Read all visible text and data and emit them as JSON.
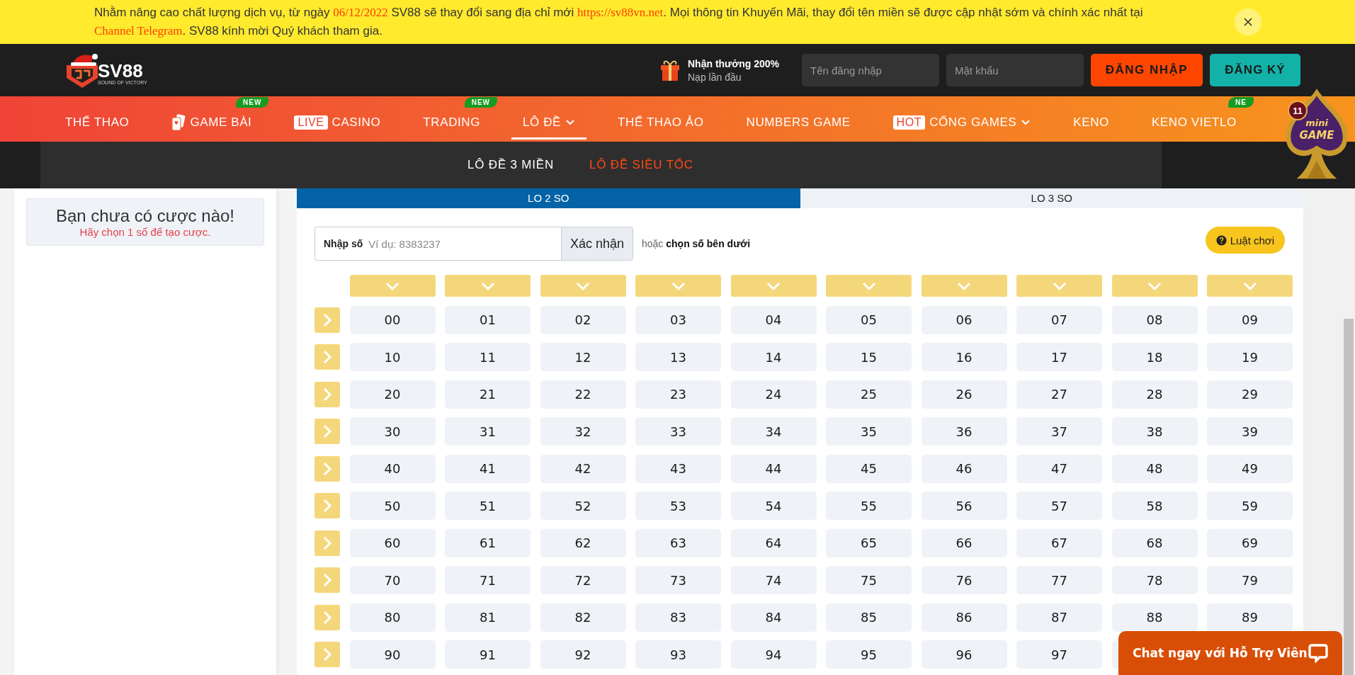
{
  "notice": {
    "segments": [
      {
        "kind": "text",
        "text": "Nhằm nâng cao chất lượng dịch vụ, từ ngày "
      },
      {
        "kind": "highlight",
        "text": "06/12/2022"
      },
      {
        "kind": "text",
        "text": " SV88 sẽ thay đổi sang địa chỉ mới "
      },
      {
        "kind": "link",
        "text": "https://sv88vn.net"
      },
      {
        "kind": "text",
        "text": ". Mọi thông tin Khuyến Mãi, thay đổi tên miền sẽ được cập nhật sớm và chính xác nhất tại "
      },
      {
        "kind": "link",
        "text": "Channel Telegram"
      },
      {
        "kind": "text",
        "text": ". SV88 kính mời Quý khách tham gia."
      }
    ]
  },
  "header": {
    "logo": {
      "name": "SV88",
      "tagline": "SOUND OF VICTORY"
    },
    "promo": {
      "title": "Nhận thưởng 200%",
      "subtitle": "Nạp lần đầu"
    },
    "username": {
      "placeholder": "Tên đăng nhập"
    },
    "password": {
      "placeholder": "Mật khẩu"
    },
    "buttons": [
      {
        "kind": "login",
        "label": "ĐĂNG NHẬP"
      },
      {
        "kind": "register",
        "label": "ĐĂNG KÝ"
      }
    ]
  },
  "nav": [
    {
      "label": "THỂ THAO",
      "selected": false
    },
    {
      "label": "GAME BÀI",
      "kind": "cards",
      "badge": "NEW",
      "selected": false
    },
    {
      "label": "CASINO",
      "prefix": "LIVE",
      "selected": false
    },
    {
      "label": "TRADING",
      "badge": "NEW",
      "selected": false
    },
    {
      "label": "LÔ ĐỀ",
      "caret": true,
      "selected": true
    },
    {
      "label": "THỂ THAO ẢO",
      "selected": false
    },
    {
      "label": "NUMBERS GAME",
      "selected": false
    },
    {
      "label": "CỔNG GAMES",
      "prefix": "HOT",
      "caret": true,
      "selected": false
    },
    {
      "label": "KENO",
      "selected": false
    },
    {
      "label": "KENO VIETLO",
      "badge": "NE",
      "selected": false
    }
  ],
  "submenu": [
    {
      "label": "LÔ ĐỀ 3 MIỀN",
      "selected": false
    },
    {
      "label": "LÔ ĐỀ SIÊU TỐC",
      "selected": true
    }
  ],
  "mini_game": {
    "count": "11",
    "line_1": "mini",
    "line_2": "GAME"
  },
  "bet_slip": {
    "title": "Bạn chưa có cược nào!",
    "hint": "Hãy chọn 1 số để tạo cược."
  },
  "tabs": [
    {
      "label": "LO 2 SO",
      "selected": true
    },
    {
      "label": "LO 3 SO",
      "selected": false
    }
  ],
  "entry": {
    "label": "Nhập số",
    "placeholder": "Ví dụ: 8383237",
    "button": "Xác nhận",
    "note": "hoặc **chọn số bên dưới**"
  },
  "rules_button": {
    "label": "Luật chơi"
  },
  "grid": {
    "rows": [
      [
        "00",
        "01",
        "02",
        "03",
        "04",
        "05",
        "06",
        "07",
        "08",
        "09"
      ],
      [
        "10",
        "11",
        "12",
        "13",
        "14",
        "15",
        "16",
        "17",
        "18",
        "19"
      ],
      [
        "20",
        "21",
        "22",
        "23",
        "24",
        "25",
        "26",
        "27",
        "28",
        "29"
      ],
      [
        "30",
        "31",
        "32",
        "33",
        "34",
        "35",
        "36",
        "37",
        "38",
        "39"
      ],
      [
        "40",
        "41",
        "42",
        "43",
        "44",
        "45",
        "46",
        "47",
        "48",
        "49"
      ],
      [
        "50",
        "51",
        "52",
        "53",
        "54",
        "55",
        "56",
        "57",
        "58",
        "59"
      ],
      [
        "60",
        "61",
        "62",
        "63",
        "64",
        "65",
        "66",
        "67",
        "68",
        "69"
      ],
      [
        "70",
        "71",
        "72",
        "73",
        "74",
        "75",
        "76",
        "77",
        "78",
        "79"
      ],
      [
        "80",
        "81",
        "82",
        "83",
        "84",
        "85",
        "86",
        "87",
        "88",
        "89"
      ],
      [
        "90",
        "91",
        "92",
        "93",
        "94",
        "95",
        "96",
        "97"
      ]
    ]
  },
  "chat": {
    "label": "Chat ngay với Hỗ Trợ Viên"
  }
}
